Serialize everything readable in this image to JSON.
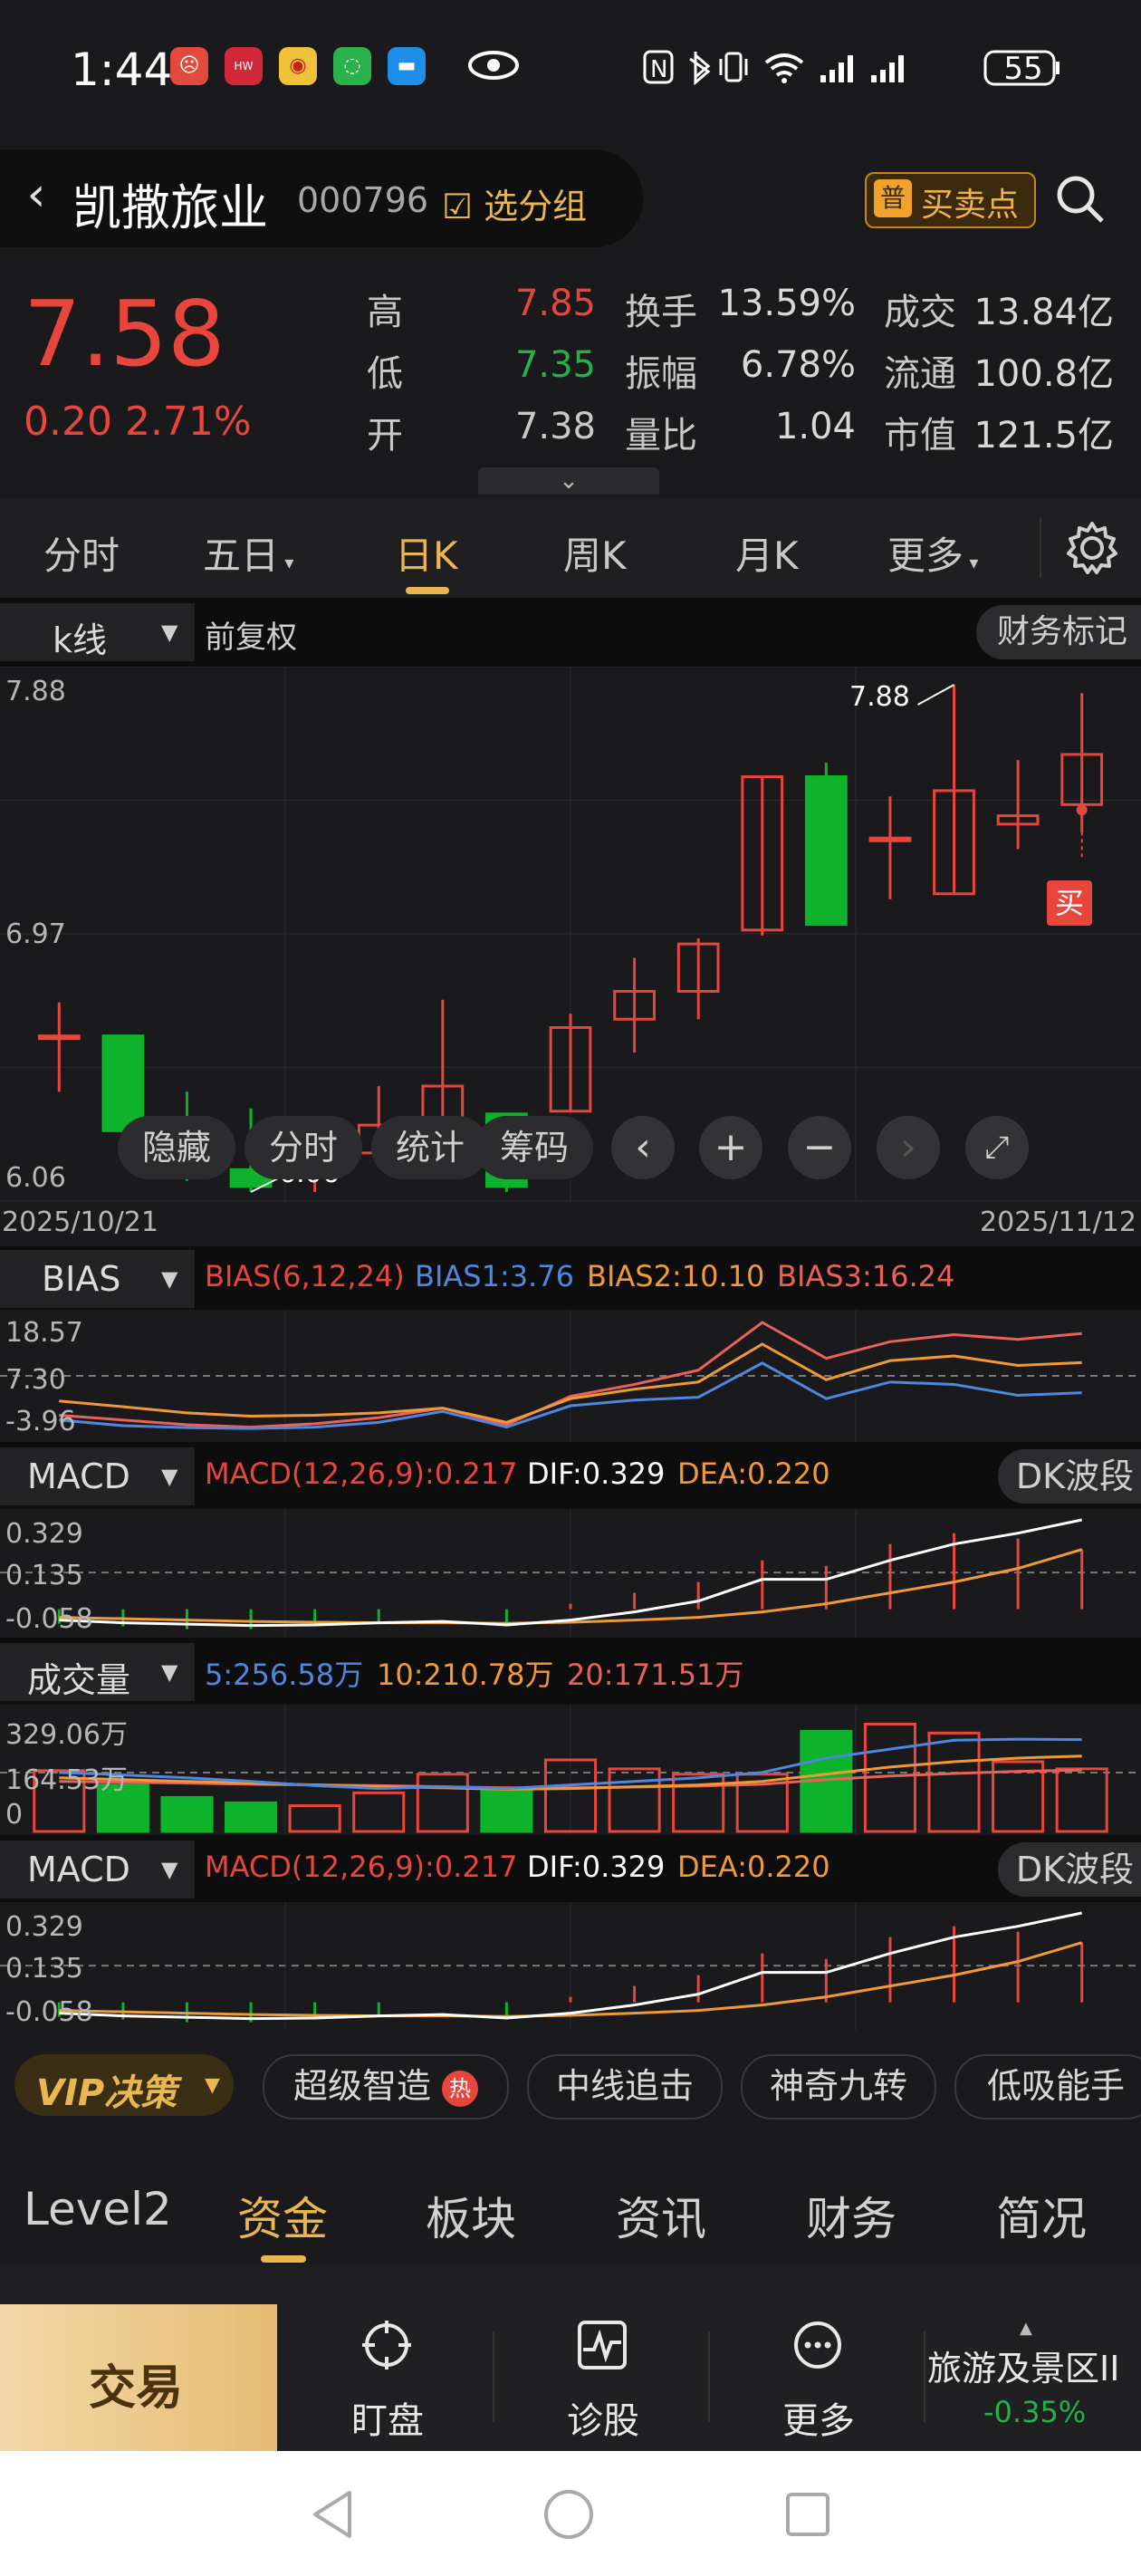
{
  "status_bar": {
    "time": "1:44",
    "battery": "55",
    "icons": [
      "app-red-icon",
      "huawei-icon",
      "weibo-icon",
      "wechat-icon",
      "message-icon",
      "eye-icon",
      "nfc-icon",
      "bluetooth-icon",
      "vibrate-icon",
      "wifi-icon",
      "signal-icon",
      "signal-icon-2",
      "battery-icon"
    ]
  },
  "header": {
    "name": "凯撒旅业",
    "code": "000796",
    "watchlist_label": "选分组",
    "trade_badge_char": "普",
    "trade_label": "买卖点"
  },
  "quote": {
    "price": "7.58",
    "change": "0.20 2.71%",
    "rows": [
      {
        "l1": "高",
        "v1": "7.85",
        "l2": "换手",
        "v2": "13.59%",
        "l3": "成交",
        "v3": "13.84亿"
      },
      {
        "l1": "低",
        "v1": "7.35",
        "l2": "振幅",
        "v2": "6.78%",
        "l3": "流通",
        "v3": "100.8亿"
      },
      {
        "l1": "开",
        "v1": "7.38",
        "l2": "量比",
        "v2": "1.04",
        "l3": "市值",
        "v3": "121.5亿"
      }
    ]
  },
  "period_tabs": [
    "分时",
    "五日",
    "日K",
    "周K",
    "月K",
    "更多"
  ],
  "kline": {
    "selector": "k线",
    "adjust": "前复权",
    "finance_mark": "财务标记",
    "y_labels": [
      "7.88",
      "6.97",
      "6.06"
    ],
    "high_note": "7.88",
    "low_note": "6.06",
    "buy_marker": "买",
    "date_start": "2025/10/21",
    "date_end": "2025/11/12",
    "tools": [
      "隐藏",
      "分时",
      "统计",
      "筹码"
    ],
    "colors": {
      "up": "#e8453c",
      "down": "#0db32a"
    },
    "candles": [
      {
        "o": 6.62,
        "c": 6.62,
        "h": 6.74,
        "l": 6.42
      },
      {
        "o": 6.62,
        "c": 6.28,
        "h": 6.62,
        "l": 6.2
      },
      {
        "o": 6.28,
        "c": 6.14,
        "h": 6.42,
        "l": 6.1
      },
      {
        "o": 6.14,
        "c": 6.08,
        "h": 6.36,
        "l": 6.06
      },
      {
        "o": 6.16,
        "c": 6.18,
        "h": 6.3,
        "l": 6.06
      },
      {
        "o": 6.2,
        "c": 6.3,
        "h": 6.44,
        "l": 6.15
      },
      {
        "o": 6.3,
        "c": 6.44,
        "h": 6.75,
        "l": 6.28
      },
      {
        "o": 6.34,
        "c": 6.08,
        "h": 6.34,
        "l": 6.06
      },
      {
        "o": 6.35,
        "c": 6.65,
        "h": 6.7,
        "l": 6.35
      },
      {
        "o": 6.68,
        "c": 6.78,
        "h": 6.9,
        "l": 6.56
      },
      {
        "o": 6.78,
        "c": 6.95,
        "h": 6.97,
        "l": 6.68
      },
      {
        "o": 7.0,
        "c": 7.55,
        "h": 7.55,
        "l": 6.98
      },
      {
        "o": 7.55,
        "c": 7.02,
        "h": 7.6,
        "l": 7.02
      },
      {
        "o": 7.33,
        "c": 7.33,
        "h": 7.48,
        "l": 7.11
      },
      {
        "o": 7.13,
        "c": 7.5,
        "h": 7.88,
        "l": 7.13
      },
      {
        "o": 7.38,
        "c": 7.41,
        "h": 7.61,
        "l": 7.29
      },
      {
        "o": 7.45,
        "c": 7.63,
        "h": 7.85,
        "l": 7.35
      }
    ]
  },
  "bias": {
    "selector": "BIAS",
    "title": "BIAS(6,12,24)",
    "b1": "BIAS1:3.76",
    "b2": "BIAS2:10.10",
    "b3": "BIAS3:16.24",
    "y_labels": [
      "18.57",
      "7.30",
      "-3.96"
    ],
    "colors": {
      "b1": "#4f86e0",
      "b2": "#f09a37",
      "b3": "#e8625a"
    },
    "series": {
      "b1": [
        -2.0,
        -3.2,
        -3.6,
        -3.8,
        -3.5,
        -2.5,
        -0.2,
        -3.5,
        1.0,
        2.2,
        2.8,
        10.0,
        2.5,
        6.0,
        5.5,
        3.2,
        3.76
      ],
      "b2": [
        2.0,
        0.8,
        -0.5,
        -1.2,
        -1.0,
        -0.5,
        0.5,
        -2.5,
        2.5,
        4.5,
        6.0,
        14.0,
        6.5,
        10.5,
        11.5,
        9.5,
        10.1
      ],
      "b3": [
        -1.0,
        -2.0,
        -3.0,
        -3.5,
        -2.8,
        -1.5,
        0.5,
        -3.0,
        3.0,
        5.5,
        8.5,
        18.57,
        11.0,
        14.5,
        16.0,
        15.0,
        16.24
      ]
    }
  },
  "macd": {
    "selector": "MACD",
    "title": "MACD(12,26,9):0.217",
    "dif": "DIF:0.329",
    "dea": "DEA:0.220",
    "badge": "DK波段",
    "y_labels": [
      "0.329",
      "0.135",
      "-0.058"
    ],
    "dif_series": [
      -0.04,
      -0.05,
      -0.055,
      -0.06,
      -0.058,
      -0.05,
      -0.045,
      -0.058,
      -0.04,
      -0.01,
      0.03,
      0.11,
      0.11,
      0.18,
      0.24,
      0.28,
      0.329
    ],
    "dea_series": [
      -0.03,
      -0.035,
      -0.04,
      -0.045,
      -0.048,
      -0.05,
      -0.05,
      -0.052,
      -0.048,
      -0.04,
      -0.03,
      -0.01,
      0.02,
      0.06,
      0.1,
      0.15,
      0.22
    ],
    "hist": [
      -0.01,
      -0.015,
      -0.02,
      -0.02,
      -0.015,
      -0.01,
      0.0,
      -0.01,
      0.01,
      0.03,
      0.05,
      0.09,
      0.08,
      0.12,
      0.14,
      0.13,
      0.11
    ]
  },
  "volume": {
    "selector": "成交量",
    "ma5": "5:256.58万",
    "ma10": "10:210.78万",
    "ma20": "20:171.51万",
    "y_labels": [
      "329.06万",
      "164.53万",
      "0"
    ],
    "values": [
      170,
      130,
      95,
      80,
      72,
      108,
      160,
      120,
      200,
      175,
      160,
      160,
      280,
      300,
      275,
      195,
      175
    ],
    "ma5_series": [
      165,
      158,
      150,
      140,
      128,
      120,
      125,
      120,
      130,
      140,
      150,
      165,
      205,
      230,
      255,
      258,
      256.58
    ],
    "ma10_series": [
      150,
      145,
      140,
      135,
      130,
      125,
      122,
      118,
      120,
      125,
      130,
      140,
      160,
      180,
      195,
      205,
      210.78
    ],
    "ma20_series": [
      140,
      138,
      135,
      132,
      130,
      128,
      125,
      122,
      122,
      124,
      127,
      132,
      145,
      155,
      162,
      168,
      171.51
    ]
  },
  "macd2": {
    "selector": "MACD",
    "title": "MACD(12,26,9):0.217",
    "dif": "DIF:0.329",
    "dea": "DEA:0.220",
    "badge": "DK波段",
    "y_labels": [
      "0.329",
      "0.135",
      "-0.058"
    ]
  },
  "strategy": {
    "vip_label": "VIP决策",
    "chips": [
      "超级智造",
      "中线追击",
      "神奇九转",
      "低吸能手"
    ],
    "hot_badge": "热"
  },
  "bottom_tabs": [
    "Level2",
    "资金",
    "板块",
    "资讯",
    "财务",
    "简况"
  ],
  "bottom_nav": {
    "trade": "交易",
    "items": [
      "盯盘",
      "诊股",
      "更多"
    ],
    "sector_name": "旅游及景区II",
    "sector_change": "-0.35%"
  }
}
